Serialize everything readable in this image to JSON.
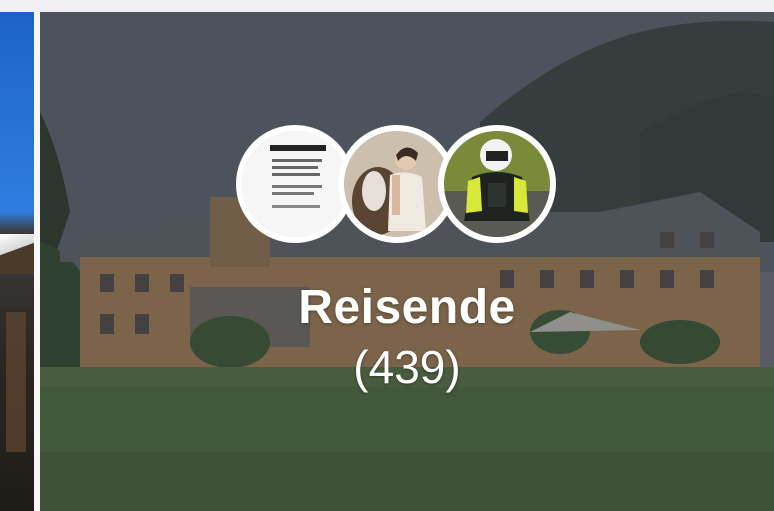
{
  "card": {
    "title": "Reisende",
    "count": "(439)",
    "background": "hotel-landscape-photo"
  },
  "avatars": [
    {
      "name": "avatar-document-icon"
    },
    {
      "name": "avatar-person-horse"
    },
    {
      "name": "avatar-motorcyclist"
    }
  ],
  "colors": {
    "sky": "#5f6670",
    "mountain": "#3f4a44",
    "building": "#a07b4f",
    "roof": "#5e6166",
    "lawn": "#4a6a3c",
    "text": "#ffffff",
    "avatar_border": "#ffffff"
  }
}
